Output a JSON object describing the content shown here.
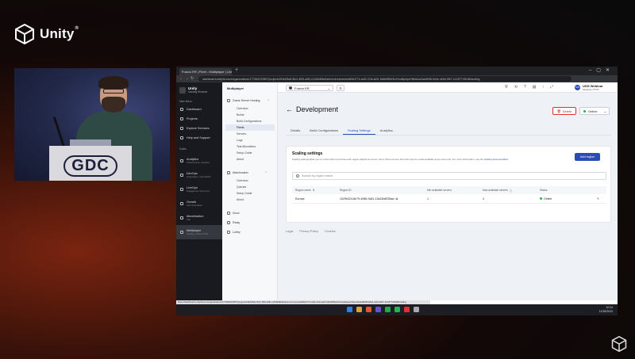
{
  "overlay": {
    "brand": "Unity",
    "registered": "®"
  },
  "camera": {
    "podium_logo": "GDC"
  },
  "browser": {
    "tab_title": "Fusion ER | Fleet - Multiplayer | Uni",
    "url": "dashboard.unity3d.com/organizations/17708419/0807/projects/f49d03a5-f5c3-4f05-a9f0-c1165d98a9ad/environments/a80b4774-af42-47af-a0f1-5a5d9f0fe3c2/multiplayer/fleets/a2aa9b98-9d4e-4e5d-9f47-1112f77491b8/scaling",
    "status_url": "https://dashboard.unity3d.com/organizations/17708419/0807/projects/f49d03a5-f5c3-4f05-a9f0-c1165d98a9ad/environments/a80b4774-af42-47af-a0f1-5a5d9f0fe3c2/multiplayer/fleets/a2aa9b98-9d4e-4e5d-9f47-1112f77491b8/scaling"
  },
  "sidebar": {
    "brand_title": "Unity",
    "brand_subtitle": "Gaming Services",
    "section_main": "Main Menu",
    "items": [
      {
        "label": "Dashboard",
        "sub": ""
      },
      {
        "label": "Projects",
        "sub": ""
      },
      {
        "label": "Explore Services",
        "sub": ""
      },
      {
        "label": "Help and Support",
        "sub": ""
      }
    ],
    "section_suites": "Suites",
    "suites": [
      {
        "label": "Analytics",
        "sub": "Infrastructure, Analytics"
      },
      {
        "label": "DevOps",
        "sub": "Integrations, Cloud Build"
      },
      {
        "label": "LiveOps",
        "sub": "Engagement, Economy"
      },
      {
        "label": "Growth",
        "sub": "User Acquisition"
      },
      {
        "label": "Monetization",
        "sub": "Ads"
      },
      {
        "label": "Multiplayer",
        "sub": "Hosting, Voice & Chat"
      }
    ]
  },
  "subnav": {
    "title": "Multiplayer",
    "group1": "Game Server Hosting",
    "group1_items": [
      "Overview",
      "Builds",
      "Build Configurations",
      "Fleets",
      "Servers",
      "Logs",
      "Test Allocations",
      "Setup Guide",
      "About"
    ],
    "group2": "Matchmaker",
    "group2_items": [
      "Overview",
      "Queues",
      "Setup Guide",
      "About"
    ],
    "bottom_items": [
      "Vivox",
      "Relay",
      "Lobby"
    ]
  },
  "topbar": {
    "project": "Fusion ER",
    "user_initials": "UW",
    "user_name": "UGS Webinar",
    "user_org": "Multiplay POST"
  },
  "page": {
    "title": "Development",
    "delete_label": "Delete",
    "status_label": "Online",
    "tabs": [
      "Details",
      "Build Configurations",
      "Scaling Settings",
      "Analytics"
    ]
  },
  "scaling": {
    "title": "Scaling settings",
    "description": "Scaling settings allow you to control when and how each region adjusts its server count. More servers than this may be made available at an extra cost. For more information, see the",
    "doc_link": "Scaling documentation",
    "add_region": "Add region",
    "search_placeholder": "Search by region name",
    "columns": [
      "Region name",
      "Region ID",
      "Min available servers",
      "Max available servers",
      "Status"
    ],
    "rows": [
      {
        "region": "Europe",
        "region_id": "1029b324-8e79-4988-9c81-13a24b8035ad",
        "min": "1",
        "max": "4",
        "status": "Online"
      }
    ]
  },
  "footer": {
    "links": [
      "Legal",
      "Privacy Policy",
      "Cookies"
    ]
  },
  "windows": {
    "time": "12:24",
    "date": "11/28/2023"
  },
  "colors": {
    "accent": "#2b4cb3",
    "online": "#2bb04a",
    "danger": "#cc2222"
  }
}
